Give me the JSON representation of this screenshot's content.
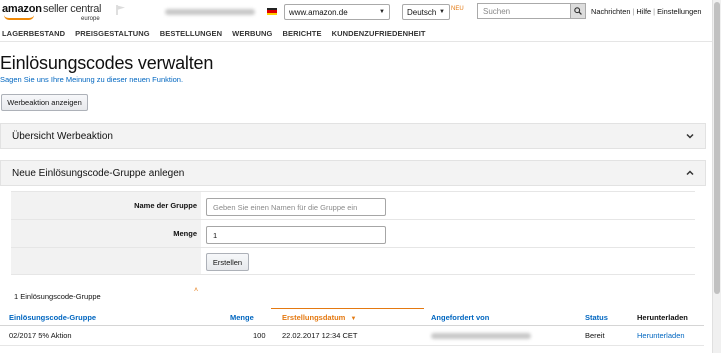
{
  "header": {
    "logo_amazon": "amazon",
    "logo_product": "seller central",
    "logo_region": "europe",
    "marketplace": "www.amazon.de",
    "language": "Deutsch",
    "new_badge": "NEU",
    "search_placeholder": "Suchen",
    "links": [
      "Nachrichten",
      "Hilfe",
      "Einstellungen"
    ]
  },
  "nav": [
    "LAGERBESTAND",
    "PREISGESTALTUNG",
    "BESTELLUNGEN",
    "WERBUNG",
    "BERICHTE",
    "KUNDENZUFRIEDENHEIT"
  ],
  "page": {
    "title": "Einlösungscodes verwalten",
    "feedback_link": "Sagen Sie uns Ihre Meinung zu dieser neuen Funktion.",
    "show_promo_button": "Werbeaktion anzeigen"
  },
  "panels": {
    "overview": "Übersicht Werbeaktion",
    "new_group": "Neue Einlösungscode-Gruppe anlegen"
  },
  "form": {
    "group_name_label": "Name der Gruppe",
    "group_name_placeholder": "Geben Sie einen Namen für die Gruppe ein",
    "quantity_label": "Menge",
    "quantity_value": "1",
    "create_button": "Erstellen"
  },
  "table": {
    "count_text": "1 Einlösungscode-Gruppe",
    "headers": [
      "Einlösungscode-Gruppe",
      "Menge",
      "Erstellungsdatum",
      "Angefordert von",
      "Status",
      "Herunterladen"
    ],
    "sort_indicator": "▼",
    "rows": [
      {
        "group": "02/2017 5% Aktion",
        "quantity": "100",
        "created": "22.02.2017 12:34 CET",
        "status": "Bereit",
        "download": "Herunterladen"
      }
    ]
  },
  "colors": {
    "link": "#0066c0",
    "accent": "#e47911",
    "panel_bg": "#f3f3f3"
  }
}
